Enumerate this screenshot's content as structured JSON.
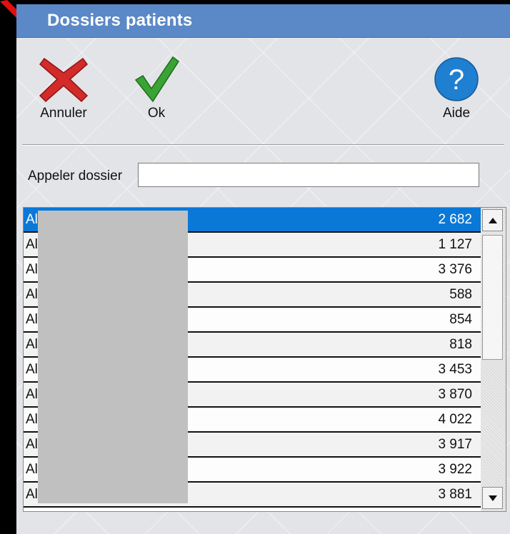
{
  "window": {
    "title": "Dossiers patients"
  },
  "toolbar": {
    "cancel_label": "Annuler",
    "ok_label": "Ok",
    "help_label": "Aide",
    "help_glyph": "?"
  },
  "call": {
    "label": "Appeler dossier",
    "value": ""
  },
  "list": {
    "rows": [
      {
        "name": "Al",
        "number": "2 682",
        "selected": true
      },
      {
        "name": "Al",
        "number": "1 127"
      },
      {
        "name": "Al",
        "number": "3 376"
      },
      {
        "name": "Al",
        "number": "588"
      },
      {
        "name": "Al",
        "number": "854"
      },
      {
        "name": "Al",
        "number": "818"
      },
      {
        "name": "Al",
        "number": "3 453"
      },
      {
        "name": "Al",
        "number": "3 870"
      },
      {
        "name": "Al",
        "number": "4 022"
      },
      {
        "name": "Al",
        "number": "3 917"
      },
      {
        "name": "Al",
        "number": "3 922"
      },
      {
        "name": "Al",
        "number": "3 881"
      }
    ]
  },
  "colors": {
    "titlebar": "#5b88c6",
    "selection": "#0a78d7",
    "cancel_red": "#d32a2a",
    "ok_green": "#3aa335",
    "help_blue": "#1f7fd0",
    "arrow_red": "#e01010"
  },
  "icons": {
    "cancel": "x-cross-icon",
    "ok": "checkmark-icon",
    "help": "question-mark-icon",
    "annotation": "red-arrow-icon"
  }
}
